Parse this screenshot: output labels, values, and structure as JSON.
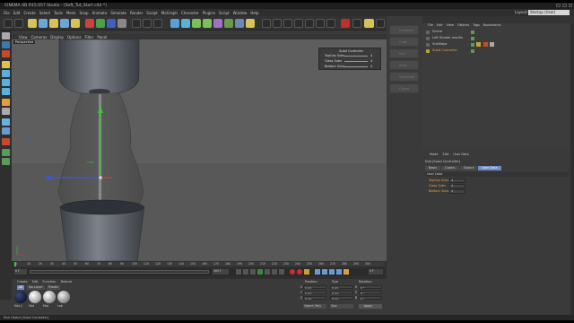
{
  "window": {
    "title": "CINEMA 4D R15.057 Studio - [Soft_Tut_Start.c4d *]"
  },
  "menubar": {
    "items": [
      "File",
      "Edit",
      "Create",
      "Select",
      "Tools",
      "Mesh",
      "Snap",
      "Animate",
      "Simulate",
      "Render",
      "Sculpt",
      "MoGraph",
      "Character",
      "Plugins",
      "Script",
      "Window",
      "Help"
    ],
    "layout_label": "Layout:",
    "layout_value": "Startup (User)"
  },
  "viewport": {
    "menu": [
      "View",
      "Cameras",
      "Display",
      "Options",
      "Filter",
      "Panel"
    ],
    "label": "Perspective",
    "hud": {
      "title": "Subd Controller",
      "rows": [
        {
          "label": "TopCap Subs",
          "value": "4"
        },
        {
          "label": "Glass Subs",
          "value": "4"
        },
        {
          "label": "Bottom Subs",
          "value": "4"
        }
      ]
    }
  },
  "timeline": {
    "ticks": [
      "0",
      "10",
      "20",
      "30",
      "40",
      "50",
      "60",
      "70",
      "80",
      "90",
      "100",
      "110",
      "120",
      "130",
      "140",
      "150",
      "160",
      "170",
      "180",
      "190",
      "200",
      "210",
      "220",
      "230",
      "240",
      "250",
      "260",
      "270",
      "280",
      "290",
      "300"
    ],
    "start_field": "0 F",
    "end_field": "300 F",
    "current_frame": "0 F"
  },
  "material_manager": {
    "menu": [
      "Create",
      "Edit",
      "Function",
      "Texture"
    ],
    "tabs": [
      "All",
      "No Layer",
      "Plastic"
    ],
    "materials": [
      {
        "name": "Mat.1",
        "color": "#0f1a35"
      },
      {
        "name": "Mat",
        "color": "#e0e0e0"
      },
      {
        "name": "Mat",
        "color": "#d6d6d6"
      },
      {
        "name": "Lab",
        "color": "#bdbdbd"
      }
    ]
  },
  "coordinates": {
    "headers": [
      "Position",
      "Size",
      "Rotation"
    ],
    "rows": [
      {
        "axis": "X",
        "pos": "0 cm",
        "size": "0 cm",
        "rot_axis": "H",
        "rot": "0 °"
      },
      {
        "axis": "Y",
        "pos": "0 cm",
        "size": "0 cm",
        "rot_axis": "P",
        "rot": "0 °"
      },
      {
        "axis": "Z",
        "pos": "0 cm",
        "size": "0 cm",
        "rot_axis": "B",
        "rot": "0 °"
      }
    ],
    "mode": "Object (Rel)",
    "size_mode": "Size",
    "apply_label": "Apply"
  },
  "side_panel": {
    "buttons": [
      "Cameras",
      "Cube",
      "Null",
      "Area",
      "Subdivide",
      "Cloner"
    ]
  },
  "object_manager": {
    "menu": [
      "File",
      "Edit",
      "View",
      "Objects",
      "Tags",
      "Bookmarks"
    ],
    "objects": [
      {
        "name": "Scene",
        "color": "#c8c8c8"
      },
      {
        "name": "Left Shader results",
        "color": "#c8c8c8"
      },
      {
        "name": "SubMajor",
        "color": "#c8c8c8"
      },
      {
        "name": "Subd Controller",
        "color": "#e8a04a"
      }
    ]
  },
  "attribute_manager": {
    "menu": [
      "Mode",
      "Edit",
      "User Data"
    ],
    "title": "Null [Subd Controller]",
    "tabs": [
      "Basic",
      "Coord.",
      "Object",
      "User Data"
    ],
    "active_tab": "User Data",
    "section": "User Data",
    "fields": [
      {
        "label": "TopCap Subs",
        "value": "4"
      },
      {
        "label": "Glass Subs",
        "value": "4"
      },
      {
        "label": "Bottom Subs",
        "value": "4"
      }
    ]
  },
  "status": {
    "text": "Null Object [Subd Controller]"
  },
  "colors": {
    "accent_orange": "#e8a04a",
    "active_tab": "#6d8bc4",
    "viewport_bg": "#5e5e5e"
  }
}
